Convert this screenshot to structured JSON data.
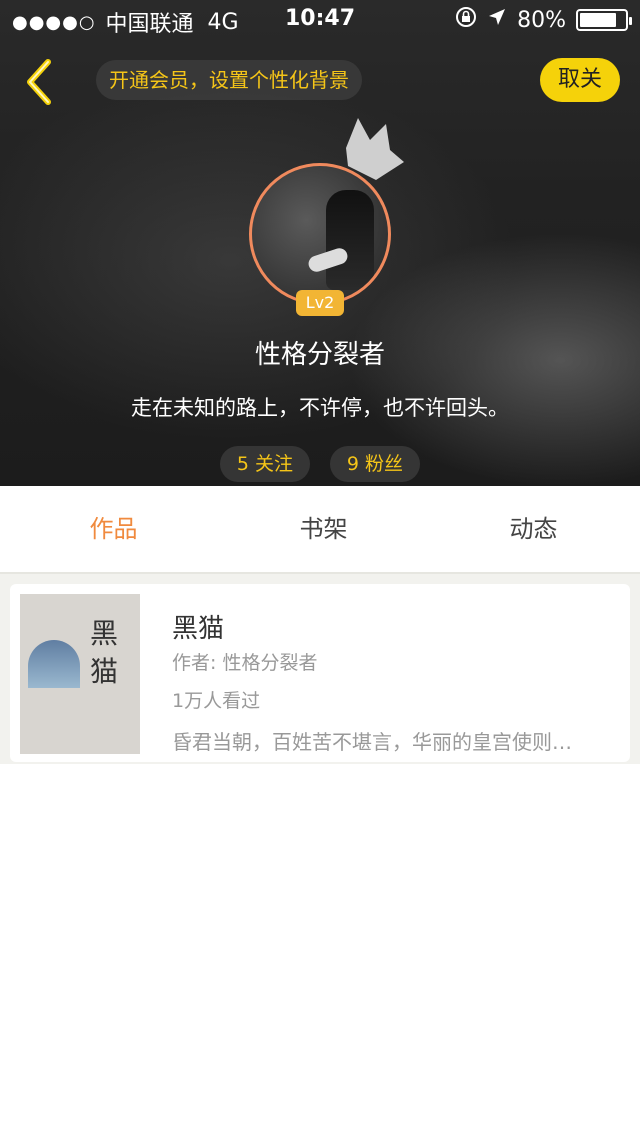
{
  "status_bar": {
    "signal": "●●●●○",
    "carrier": "中国联通",
    "network": "4G",
    "time": "10:47",
    "battery": "80%"
  },
  "header": {
    "vip_banner": "开通会员，设置个性化背景",
    "favorite_button": "取关",
    "level": "Lv2",
    "username": "性格分裂者",
    "bio": "走在未知的路上，不许停，也不许回头。",
    "following": "5 关注",
    "fans": "9 粉丝"
  },
  "tabs": [
    {
      "label": "作品",
      "active": true
    },
    {
      "label": "书架",
      "active": false
    },
    {
      "label": "动态",
      "active": false
    }
  ],
  "works": [
    {
      "cover_text_1": "黑",
      "cover_text_2": "猫",
      "title": "黑猫",
      "author": "作者: 性格分裂者",
      "views": "1万人看过",
      "description": "昏君当朝，百姓苦不堪言，华丽的皇宫使则…"
    }
  ],
  "colors": {
    "accent_yellow": "#f5d20a",
    "accent_orange": "#f08a3e",
    "level_badge": "#f2b534"
  },
  "icons": [
    "back-chevron-icon",
    "orientation-lock-icon",
    "location-arrow-icon",
    "battery-icon",
    "crown-icon"
  ]
}
